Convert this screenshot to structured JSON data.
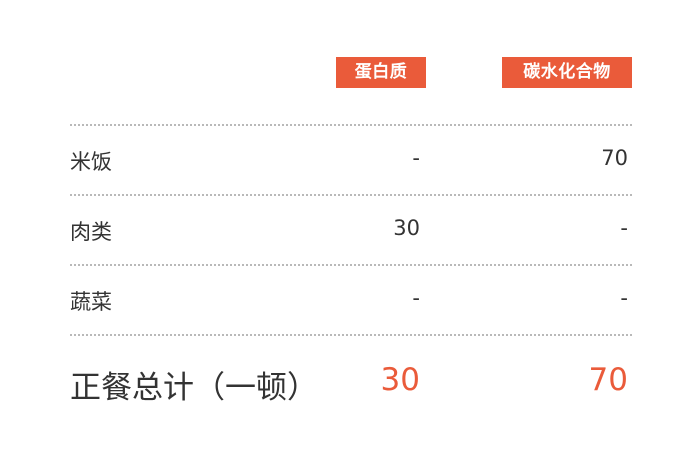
{
  "headers": {
    "protein": "蛋白质",
    "carbohydrate": "碳水化合物"
  },
  "rows": [
    {
      "label": "米饭",
      "protein": "-",
      "carbohydrate": "70"
    },
    {
      "label": "肉类",
      "protein": "30",
      "carbohydrate": "-"
    },
    {
      "label": "蔬菜",
      "protein": "-",
      "carbohydrate": "-"
    }
  ],
  "total": {
    "label": "正餐总计（一顿）",
    "protein": "30",
    "carbohydrate": "70"
  },
  "colors": {
    "accent": "#ea5b3a",
    "text": "#333333",
    "divider": "#b9b9b9"
  }
}
